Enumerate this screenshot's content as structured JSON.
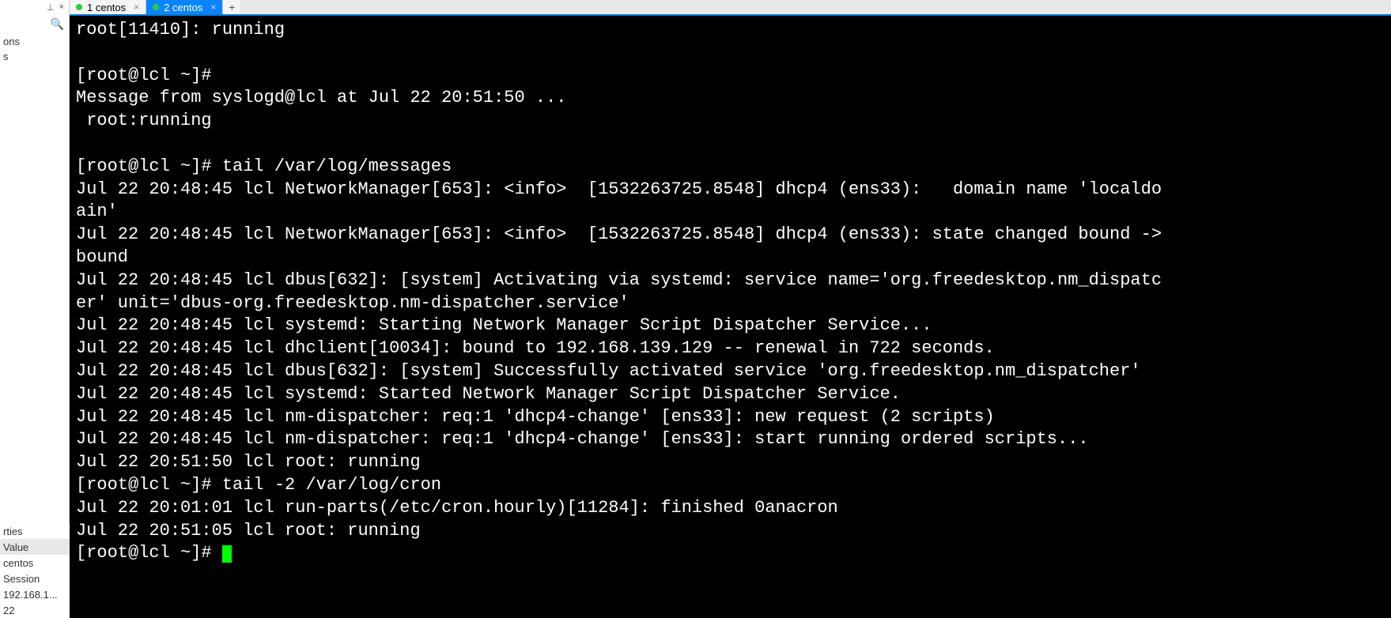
{
  "sidebar": {
    "pin_glyph": "⊥",
    "close_glyph": "×",
    "search_glyph": "🔍",
    "items": [
      "ons",
      "s"
    ],
    "properties": {
      "rows": [
        {
          "label": "rties",
          "header": false
        },
        {
          "label": "Value",
          "header": true
        },
        {
          "label": "centos",
          "header": false
        },
        {
          "label": "Session",
          "header": false
        },
        {
          "label": "192.168.1...",
          "header": false
        },
        {
          "label": "22",
          "header": false
        }
      ]
    }
  },
  "tabs": [
    {
      "label": "1 centos",
      "active": false
    },
    {
      "label": "2 centos",
      "active": true
    }
  ],
  "add_tab_glyph": "+",
  "tab_close_glyph": "×",
  "terminal": {
    "lines": [
      "root[11410]: running",
      "",
      "[root@lcl ~]# ",
      "Message from syslogd@lcl at Jul 22 20:51:50 ...",
      " root:running",
      "",
      "[root@lcl ~]# tail /var/log/messages",
      "Jul 22 20:48:45 lcl NetworkManager[653]: <info>  [1532263725.8548] dhcp4 (ens33):   domain name 'localdo",
      "ain'",
      "Jul 22 20:48:45 lcl NetworkManager[653]: <info>  [1532263725.8548] dhcp4 (ens33): state changed bound ->",
      "bound",
      "Jul 22 20:48:45 lcl dbus[632]: [system] Activating via systemd: service name='org.freedesktop.nm_dispatc",
      "er' unit='dbus-org.freedesktop.nm-dispatcher.service'",
      "Jul 22 20:48:45 lcl systemd: Starting Network Manager Script Dispatcher Service...",
      "Jul 22 20:48:45 lcl dhclient[10034]: bound to 192.168.139.129 -- renewal in 722 seconds.",
      "Jul 22 20:48:45 lcl dbus[632]: [system] Successfully activated service 'org.freedesktop.nm_dispatcher'",
      "Jul 22 20:48:45 lcl systemd: Started Network Manager Script Dispatcher Service.",
      "Jul 22 20:48:45 lcl nm-dispatcher: req:1 'dhcp4-change' [ens33]: new request (2 scripts)",
      "Jul 22 20:48:45 lcl nm-dispatcher: req:1 'dhcp4-change' [ens33]: start running ordered scripts...",
      "Jul 22 20:51:50 lcl root: running",
      "[root@lcl ~]# tail -2 /var/log/cron",
      "Jul 22 20:01:01 lcl run-parts(/etc/cron.hourly)[11284]: finished 0anacron",
      "Jul 22 20:51:05 lcl root: running"
    ],
    "prompt": "[root@lcl ~]# "
  }
}
